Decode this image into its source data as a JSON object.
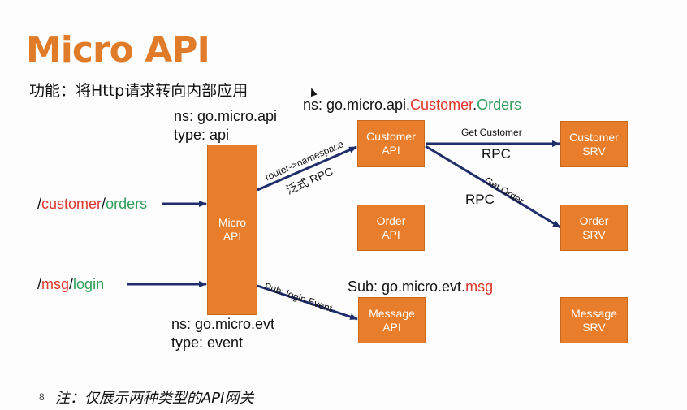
{
  "title": "Micro API",
  "subtitle": "功能：将Http请求转向内部应用",
  "gateway_labels": {
    "api_ns": "ns: go.micro.api",
    "api_type": "type: api",
    "evt_ns": "ns: go.micro.evt",
    "evt_type": "type: event"
  },
  "customer_ns": {
    "prefix": "ns: go.micro.api.",
    "service": "Customer",
    "dot": ".",
    "method": "Orders"
  },
  "sub_ns": {
    "prefix": "Sub: go.micro.evt.",
    "topic": "msg"
  },
  "paths": {
    "orders": {
      "s1": "/",
      "p1": "customer",
      "s2": "/",
      "p2": "orders"
    },
    "login": {
      "s1": "/",
      "p1": "msg",
      "s2": "/",
      "p2": "login"
    }
  },
  "boxes": {
    "micro_api": {
      "line1": "Micro",
      "line2": "API"
    },
    "customer_api": {
      "line1": "Customer",
      "line2": "API"
    },
    "order_api": {
      "line1": "Order",
      "line2": "API"
    },
    "message_api": {
      "line1": "Message",
      "line2": "API"
    },
    "customer_srv": {
      "line1": "Customer",
      "line2": "SRV"
    },
    "order_srv": {
      "line1": "Order",
      "line2": "SRV"
    },
    "message_srv": {
      "line1": "Message",
      "line2": "SRV"
    }
  },
  "edges": {
    "router": "router->namespace",
    "generic_rpc": "泛式 RPC",
    "pub": "Pub: login Event",
    "get_customer": "Get Customer",
    "rpc_top": "RPC",
    "get_order": "Get Order",
    "rpc_bottom": "RPC"
  },
  "footer": {
    "slide_number": "8",
    "note": "注：仅展示两种类型的API网关"
  },
  "colors": {
    "accent_orange": "#e87d2b",
    "title_orange": "#e07b2a",
    "arrow_navy": "#1f2d6b",
    "red": "#e0352b",
    "green": "#2e9e5a"
  }
}
